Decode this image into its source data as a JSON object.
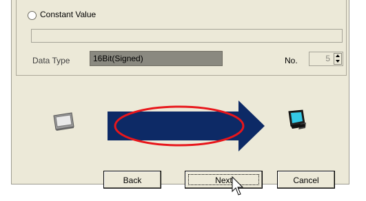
{
  "radio": {
    "label": "Constant Value",
    "selected": false
  },
  "constant_value_input": {
    "value": ""
  },
  "data_type": {
    "label": "Data Type",
    "value": "16Bit(Signed)"
  },
  "no_field": {
    "label": "No.",
    "value": "5"
  },
  "buttons": {
    "back": "Back",
    "next": "Next",
    "cancel": "Cancel"
  },
  "icons": {
    "left": "display-panel-icon",
    "right": "pc-monitor-icon",
    "arrow": "transfer-arrow",
    "highlight": "red-ellipse-highlight"
  },
  "colors": {
    "arrow": "#0d2a66",
    "highlight": "#e8161b"
  }
}
